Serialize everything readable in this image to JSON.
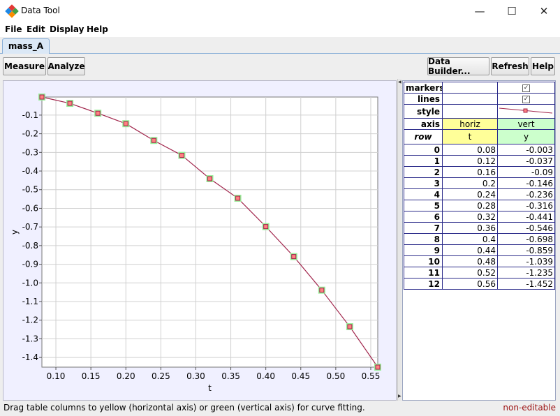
{
  "window": {
    "title": "Data Tool",
    "minimize_icon": "minimize-icon",
    "maximize_icon": "maximize-icon",
    "close_icon": "close-icon",
    "minimize_glyph": "—",
    "maximize_glyph": "☐",
    "close_glyph": "✕"
  },
  "menu": {
    "file": "File",
    "edit": "Edit",
    "display": "Display",
    "help": "Help"
  },
  "tabs": [
    {
      "label": "mass_A"
    }
  ],
  "toolbar": {
    "measure": "Measure",
    "analyze": "Analyze",
    "data_builder": "Data Builder...",
    "refresh": "Refresh",
    "help": "Help"
  },
  "table": {
    "props": {
      "markers_label": "markers",
      "lines_label": "lines",
      "style_label": "style",
      "axis_label": "axis",
      "markers_checked": true,
      "lines_checked": true,
      "axis_x": "horiz",
      "axis_y": "vert"
    },
    "headers": {
      "row": "row",
      "x": "t",
      "y": "y"
    },
    "rows": [
      {
        "row": "0",
        "t": "0.08",
        "y": "-0.003"
      },
      {
        "row": "1",
        "t": "0.12",
        "y": "-0.037"
      },
      {
        "row": "2",
        "t": "0.16",
        "y": "-0.09"
      },
      {
        "row": "3",
        "t": "0.2",
        "y": "-0.146"
      },
      {
        "row": "4",
        "t": "0.24",
        "y": "-0.236"
      },
      {
        "row": "5",
        "t": "0.28",
        "y": "-0.316"
      },
      {
        "row": "6",
        "t": "0.32",
        "y": "-0.441"
      },
      {
        "row": "7",
        "t": "0.36",
        "y": "-0.546"
      },
      {
        "row": "8",
        "t": "0.4",
        "y": "-0.698"
      },
      {
        "row": "9",
        "t": "0.44",
        "y": "-0.859"
      },
      {
        "row": "10",
        "t": "0.48",
        "y": "-1.039"
      },
      {
        "row": "11",
        "t": "0.52",
        "y": "-1.235"
      },
      {
        "row": "12",
        "t": "0.56",
        "y": "-1.452"
      }
    ]
  },
  "status": {
    "message": "Drag table columns to yellow (horizontal axis) or green (vertical axis) for curve fitting.",
    "editable": "non-editable"
  },
  "colors": {
    "horiz_bg": "#ffff99",
    "vert_bg": "#ccffcc",
    "line": "#a0234a",
    "marker_fill": "#ff8080",
    "marker_halo": "#99ee99",
    "status_right": "#9b1010"
  },
  "chart_data": {
    "type": "line",
    "xlabel": "t",
    "ylabel": "y",
    "x": [
      0.08,
      0.12,
      0.16,
      0.2,
      0.24,
      0.28,
      0.32,
      0.36,
      0.4,
      0.44,
      0.48,
      0.52,
      0.56
    ],
    "series": [
      {
        "values": [
          -0.003,
          -0.037,
          -0.09,
          -0.146,
          -0.236,
          -0.316,
          -0.441,
          -0.546,
          -0.698,
          -0.859,
          -1.039,
          -1.235,
          -1.452
        ]
      }
    ],
    "xlim": [
      0.08,
      0.56
    ],
    "ylim": [
      -1.452,
      -0.003
    ],
    "xticks": [
      "0.10",
      "0.15",
      "0.20",
      "0.25",
      "0.30",
      "0.35",
      "0.40",
      "0.45",
      "0.50",
      "0.55"
    ],
    "yticks": [
      "-0.1",
      "-0.2",
      "-0.3",
      "-0.4",
      "-0.5",
      "-0.6",
      "-0.7",
      "-0.8",
      "-0.9",
      "-1.0",
      "-1.1",
      "-1.2",
      "-1.3",
      "-1.4"
    ],
    "grid": true,
    "markers": true
  }
}
